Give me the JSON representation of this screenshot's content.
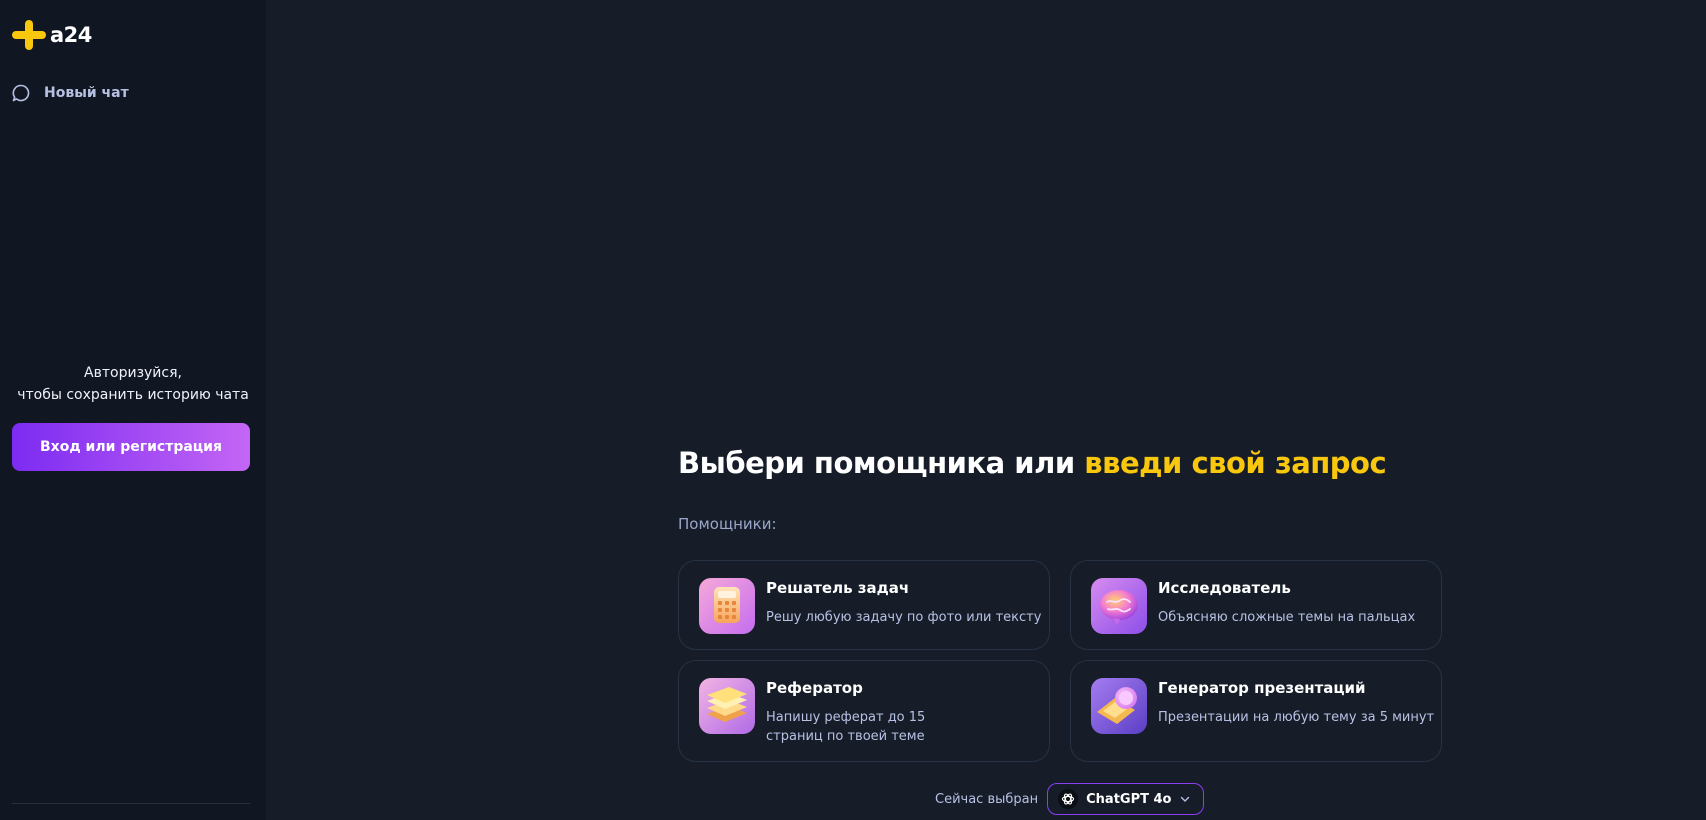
{
  "brand": {
    "name": "a24"
  },
  "sidebar": {
    "new_chat_label": "Новый чат",
    "auth_line1": "Авторизуйся,",
    "auth_line2": "чтобы сохранить историю чата",
    "login_button": "Вход или регистрация"
  },
  "main": {
    "headline_part1": "Выбери помощника или ",
    "headline_part2": "введи свой запрос",
    "assistants_label": "Помощники:",
    "assistants": [
      {
        "title": "Решатель задач",
        "desc": "Решу любую задачу по фото или тексту",
        "icon": "calculator-icon"
      },
      {
        "title": "Исследователь",
        "desc": "Объясняю сложные темы на пальцах",
        "icon": "brain-icon"
      },
      {
        "title": "Реферaтор",
        "desc_line1": "Напишу реферат до 15",
        "desc_line2": "страниц по твоей теме",
        "icon": "papers-icon"
      },
      {
        "title": "Генератор презентаций",
        "desc": "Презентации на любую тему за 5 минут",
        "icon": "presentation-icon"
      }
    ],
    "model_label": "Сейчас выбран",
    "model_name": "ChatGPT 4o"
  },
  "colors": {
    "accent_yellow": "#f9c80e",
    "accent_purple": "#8a3ff0",
    "bg": "#161d29",
    "sidebar_bg": "#111722"
  }
}
